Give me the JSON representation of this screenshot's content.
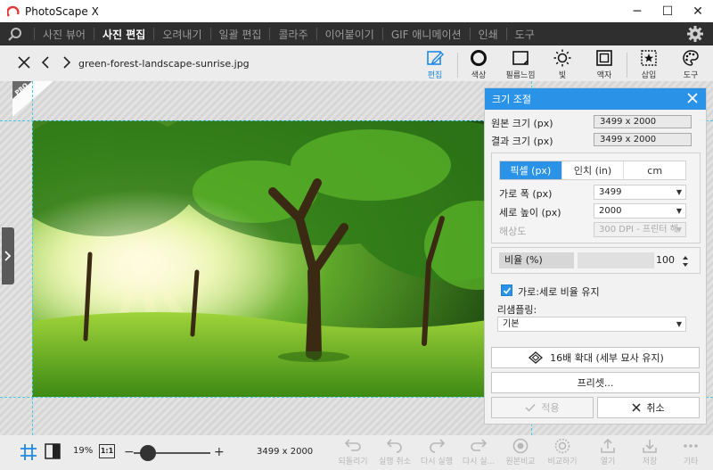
{
  "window": {
    "title": "PhotoScape X",
    "minimize": "─",
    "maximize": "☐",
    "close": "✕"
  },
  "nav": {
    "tabs": [
      "사진 뷰어",
      "사진 편집",
      "오려내기",
      "일괄 편집",
      "콜라주",
      "이어붙이기",
      "GIF 애니메이션",
      "인쇄",
      "도구"
    ],
    "active": "사진 편집"
  },
  "toolbar": {
    "filename": "green-forest-landscape-sunrise.jpg",
    "tools": [
      "편집",
      "색상",
      "필름느낌",
      "빛",
      "액자",
      "삽입",
      "도구"
    ],
    "active_tool": "편집"
  },
  "canvas": {
    "pro_badge": "PRO"
  },
  "panel": {
    "title": "크기 조절",
    "original_size_label": "원본 크기 (px)",
    "original_size_value": "3499 x 2000",
    "result_size_label": "결과 크기 (px)",
    "result_size_value": "3499 x 2000",
    "unit_tabs": [
      "픽셀 (px)",
      "인치 (in)",
      "cm"
    ],
    "width_label": "가로 폭 (px)",
    "width_value": "3499",
    "height_label": "세로 높이 (px)",
    "height_value": "2000",
    "resolution_label": "해상도",
    "resolution_value": "300 DPI - 프린터 해",
    "ratio_label": "비율 (%)",
    "ratio_value": "100",
    "keep_ratio_label": "가로:세로 비율 유지",
    "keep_ratio_checked": true,
    "resampling_label": "리샘플링:",
    "resampling_value": "기본",
    "upscale_button": "16배 확대 (세부 묘사 유지)",
    "preset_button": "프리셋...",
    "apply_button": "적용",
    "cancel_button": "취소"
  },
  "bottom": {
    "zoom": "19%",
    "actual_size": "1:1",
    "minus": "−",
    "plus": "+",
    "zoom_level": 0.19,
    "dimensions": "3499 x 2000",
    "actions": [
      "되돌리기",
      "실행 취소",
      "다시 실행",
      "다시 실...",
      "원본비교",
      "비교하기",
      "열기",
      "저장",
      "기타"
    ]
  },
  "colors": {
    "accent": "#2a93e8",
    "nav_bg": "#2f2f2f",
    "guide": "#48c7e6"
  }
}
